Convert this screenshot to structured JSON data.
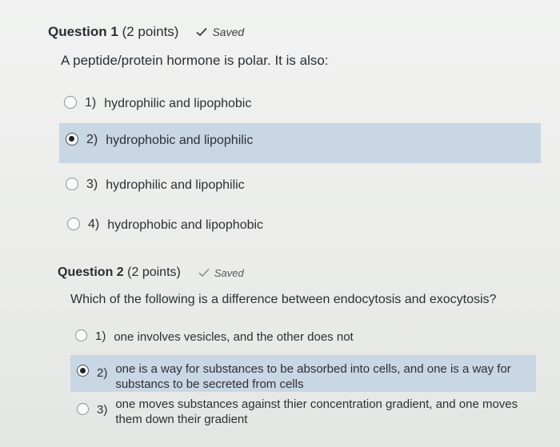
{
  "question1": {
    "title": "Question 1",
    "points": "(2 points)",
    "saved_label": "Saved",
    "prompt": "A peptide/protein hormone is polar. It is also:",
    "options": [
      {
        "num": "1)",
        "text": "hydrophilic and lipophobic",
        "selected": false
      },
      {
        "num": "2)",
        "text": "hydrophobic and lipophilic",
        "selected": true
      },
      {
        "num": "3)",
        "text": "hydrophilic and lipophilic",
        "selected": false
      },
      {
        "num": "4)",
        "text": "hydrophobic and lipophobic",
        "selected": false
      }
    ]
  },
  "question2": {
    "title": "Question 2",
    "points": "(2 points)",
    "saved_label": "Saved",
    "prompt": "Which of the following is a difference between endocytosis and exocytosis?",
    "options": [
      {
        "num": "1)",
        "text": "one involves vesicles, and the other does not",
        "selected": false
      },
      {
        "num": "2)",
        "text": "one is a way for substances to be absorbed into cells, and one is a way for substancs to be secreted from cells",
        "selected": true
      },
      {
        "num": "3)",
        "text": "one moves substances against thier concentration gradient, and one moves them down their gradient",
        "selected": false
      }
    ]
  },
  "colors": {
    "selected_bg": "#c9d6e3",
    "text": "#2c3036",
    "page_bg": "#ecedec"
  },
  "icons": {
    "saved": "checkmark-icon",
    "radio": "radio-button"
  }
}
